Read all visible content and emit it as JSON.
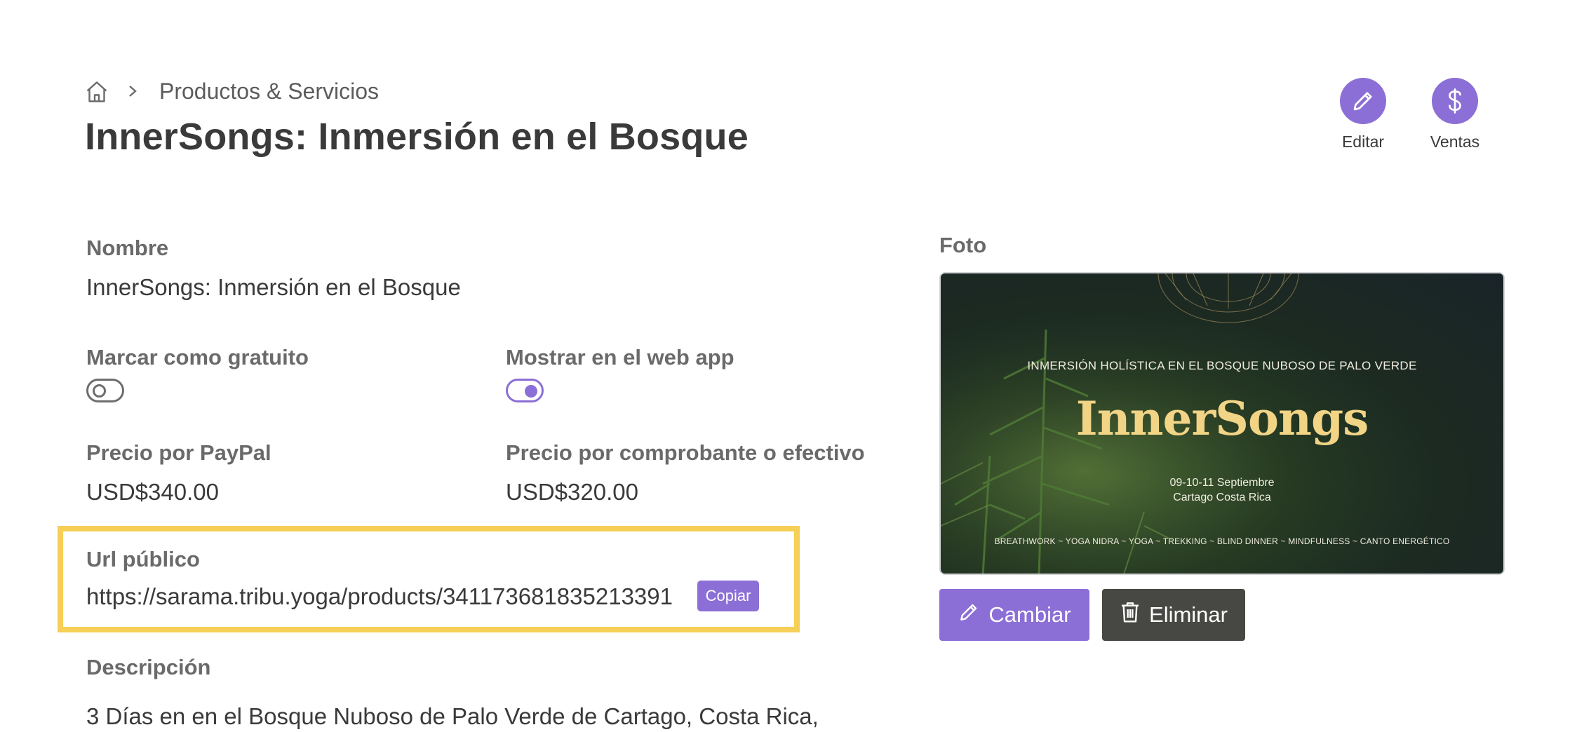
{
  "breadcrumb": {
    "link": "Productos & Servicios"
  },
  "page": {
    "title": "InnerSongs: Inmersión en el Bosque"
  },
  "actions": {
    "edit": "Editar",
    "sales": "Ventas"
  },
  "fields": {
    "name": {
      "label": "Nombre",
      "value": "InnerSongs: Inmersión en el Bosque"
    },
    "free": {
      "label": "Marcar como gratuito",
      "checked": false
    },
    "webapp": {
      "label": "Mostrar en el web app",
      "checked": true
    },
    "price_paypal": {
      "label": "Precio por PayPal",
      "value": "USD$340.00"
    },
    "price_cash": {
      "label": "Precio por comprobante o efectivo",
      "value": "USD$320.00"
    },
    "public_url": {
      "label": "Url público",
      "value": "https://sarama.tribu.yoga/products/341173681835213391",
      "copy": "Copiar"
    },
    "description": {
      "label": "Descripción",
      "value": "3 Días en en el Bosque Nuboso de Palo Verde de Cartago, Costa Rica,"
    }
  },
  "photo": {
    "label": "Foto",
    "subheading": "INMERSIÓN HOLÍSTICA EN EL BOSQUE NUBOSO DE PALO VERDE",
    "brand": "InnerSongs",
    "date": "09-10-11  Septiembre",
    "place": "Cartago Costa Rica",
    "activities": "BREATHWORK  ~ YOGA NIDRA ~ YOGA ~ TREKKING ~ BLIND DINNER ~ MINDFULNESS ~ CANTO ENERGÉTICO",
    "change": "Cambiar",
    "delete": "Eliminar"
  },
  "colors": {
    "accent": "#8b6fd6",
    "highlight": "#f5cf56",
    "dark_button": "#474744"
  }
}
